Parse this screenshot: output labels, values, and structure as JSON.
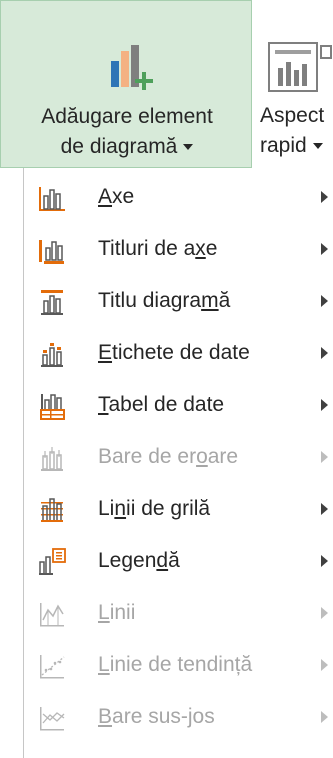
{
  "ribbon": {
    "add_element": {
      "line1": "Adăugare element",
      "line2": "de diagramă"
    },
    "quick_layout": {
      "line1": "Aspect",
      "line2": "rapid"
    }
  },
  "menu": {
    "items": [
      {
        "pre": "",
        "key": "A",
        "post": "xe",
        "enabled": true,
        "icon": "axes-icon"
      },
      {
        "pre": "Titluri de a",
        "key": "x",
        "post": "e",
        "enabled": true,
        "icon": "axis-titles-icon"
      },
      {
        "pre": "Titlu diagra",
        "key": "m",
        "post": "ă",
        "enabled": true,
        "icon": "chart-title-icon"
      },
      {
        "pre": "",
        "key": "E",
        "post": "tichete de date",
        "enabled": true,
        "icon": "data-labels-icon"
      },
      {
        "pre": "",
        "key": "T",
        "post": "abel de date",
        "enabled": true,
        "icon": "data-table-icon"
      },
      {
        "pre": "Bare de er",
        "key": "o",
        "post": "are",
        "enabled": false,
        "icon": "error-bars-icon"
      },
      {
        "pre": "Li",
        "key": "n",
        "post": "ii de grilă",
        "enabled": true,
        "icon": "gridlines-icon"
      },
      {
        "pre": "Legen",
        "key": "d",
        "post": "ă",
        "enabled": true,
        "icon": "legend-icon"
      },
      {
        "pre": "",
        "key": "L",
        "post": "inii",
        "enabled": false,
        "icon": "lines-icon"
      },
      {
        "pre": "",
        "key": "L",
        "post": "inie de tendință",
        "enabled": false,
        "icon": "trendline-icon"
      },
      {
        "pre": "",
        "key": "B",
        "post": "are sus-jos",
        "enabled": false,
        "icon": "up-down-bars-icon"
      }
    ]
  }
}
